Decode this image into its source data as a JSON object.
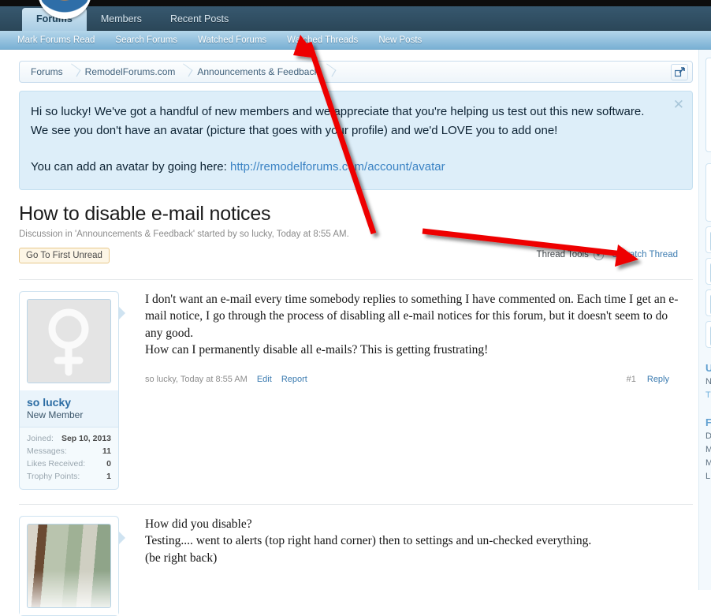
{
  "nav": {
    "primary": [
      {
        "label": "Forums",
        "active": true
      },
      {
        "label": "Members",
        "active": false
      },
      {
        "label": "Recent Posts",
        "active": false
      }
    ],
    "secondary": [
      "Mark Forums Read",
      "Search Forums",
      "Watched Forums",
      "Watched Threads",
      "New Posts"
    ]
  },
  "breadcrumb": {
    "items": [
      "Forums",
      "RemodelForums.com",
      "Announcements & Feedback"
    ],
    "popup_icon": "open-in-new-window-icon"
  },
  "notice": {
    "paragraph1": "Hi so lucky! We've got a handful of new members and we appreciate that you're helping us test out this new software. We see you don't have an avatar (picture that goes with your profile) and we'd LOVE you to add one!",
    "paragraph2_prefix": "You can add an avatar by going here: ",
    "link_text": "http://remodelforums.com/account/avatar",
    "close_icon": "close-icon",
    "background": "#ddeef9",
    "link_color": "#3b83c4"
  },
  "thread": {
    "title": "How to disable e-mail notices",
    "subtitle": "Discussion in 'Announcements & Feedback' started by so lucky, Today at 8:55 AM.",
    "go_to_first_unread": "Go To First Unread",
    "thread_tools": "Thread Tools",
    "thread_tools_icon": "chevron-down-icon",
    "unwatch_thread": "Unwatch Thread",
    "unwatch_color": "#3b7bb0"
  },
  "posts": [
    {
      "avatar_type": "venus-placeholder-icon",
      "username": "so lucky",
      "user_title": "New Member",
      "stats": [
        {
          "label": "Joined:",
          "value": "Sep 10, 2013"
        },
        {
          "label": "Messages:",
          "value": "11"
        },
        {
          "label": "Likes Received:",
          "value": "0"
        },
        {
          "label": "Trophy Points:",
          "value": "1"
        }
      ],
      "body_lines": [
        "I don't want an e-mail every time somebody replies to something I have commented on. Each time I get an e-mail notice, I go through the process of disabling all e-mail notices for this forum, but it doesn't seem to do any good.",
        "How can I permanently disable all e-mails? This is getting frustrating!"
      ],
      "footer_meta": "so lucky, Today at 8:55 AM",
      "footer_links": [
        "Edit",
        "Report"
      ],
      "post_number": "#1",
      "reply_label": "Reply"
    },
    {
      "avatar_type": "photo-avatar",
      "body_lines": [
        "How did you disable?",
        "Testing.... went to alerts (top right hand corner) then to settings and un-checked everything.",
        "(be right back)"
      ]
    }
  ],
  "sidebar": {
    "heading1": "U",
    "line1": "N",
    "line2": "T",
    "heading2": "F",
    "lines2": [
      "D",
      "M",
      "M",
      "L"
    ]
  },
  "annotations": {
    "arrow_color": "#ee0000",
    "arrow1_target": "Watched Threads",
    "arrow2_target": "Unwatch Thread"
  }
}
